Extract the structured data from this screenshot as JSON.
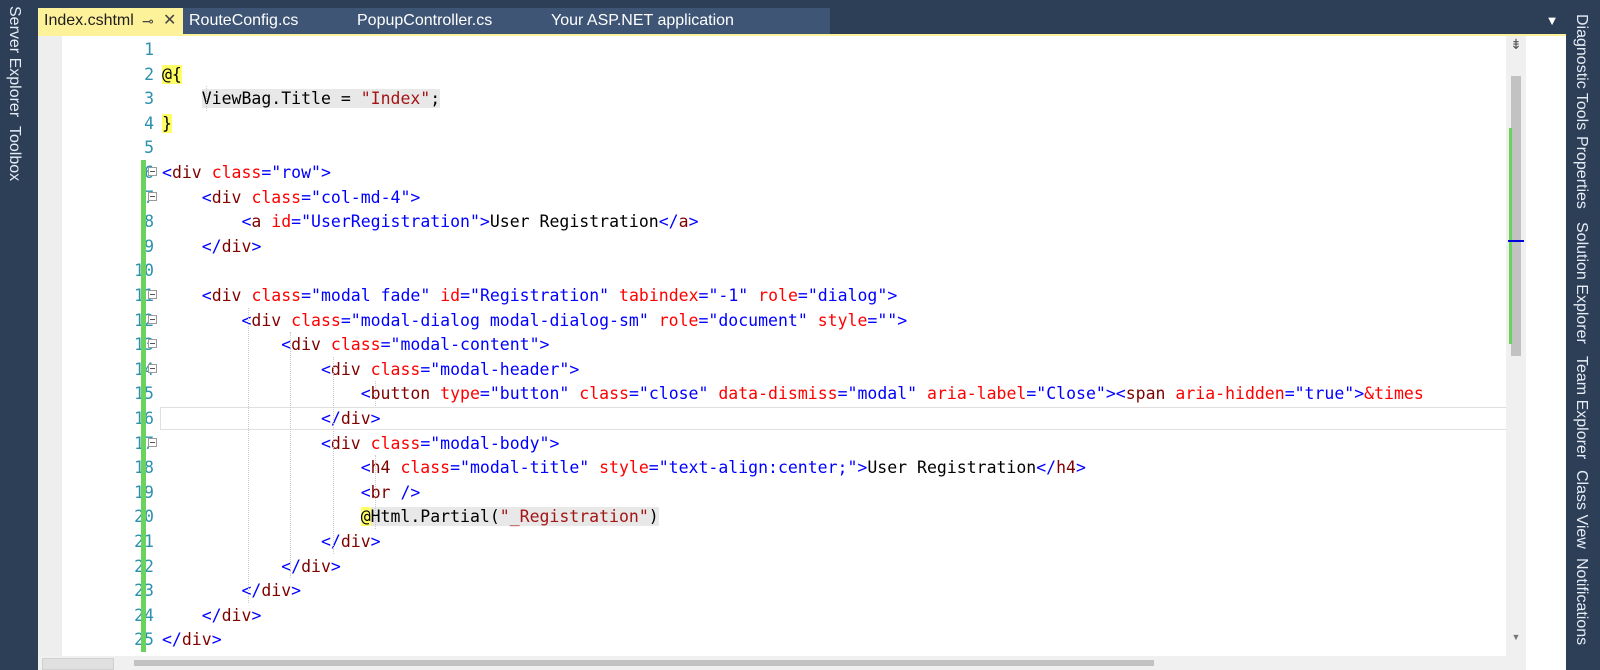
{
  "tabs": [
    {
      "label": "Index.cshtml",
      "active": true
    },
    {
      "label": "RouteConfig.cs",
      "active": false
    },
    {
      "label": "PopupController.cs",
      "active": false
    },
    {
      "label": "Your ASP.NET application",
      "active": false
    }
  ],
  "tab_icons": {
    "pin": "pin-icon",
    "close": "close-icon",
    "overflow": "dropdown-arrow-icon"
  },
  "tab_glyphs": {
    "pin": "⊸",
    "close": "✕",
    "overflow": "▼"
  },
  "left_panels": [
    "Server Explorer",
    "Toolbox"
  ],
  "right_panels": [
    "Diagnostic Tools",
    "Properties",
    "Solution Explorer",
    "Team Explorer",
    "Class View",
    "Notifications"
  ],
  "editor": {
    "lines": [
      {
        "number": "1",
        "text": ""
      },
      {
        "number": "2",
        "text": "@{"
      },
      {
        "number": "3",
        "text": "    ViewBag.Title = \"Index\";"
      },
      {
        "number": "4",
        "text": "}"
      },
      {
        "number": "5",
        "text": ""
      },
      {
        "number": "6",
        "text": "<div class=\"row\">"
      },
      {
        "number": "7",
        "text": "    <div class=\"col-md-4\">"
      },
      {
        "number": "8",
        "text": "        <a id=\"UserRegistration\">User Registration</a>"
      },
      {
        "number": "9",
        "text": "    </div>"
      },
      {
        "number": "10",
        "text": ""
      },
      {
        "number": "11",
        "text": "    <div class=\"modal fade\" id=\"Registration\" tabindex=\"-1\" role=\"dialog\">"
      },
      {
        "number": "12",
        "text": "        <div class=\"modal-dialog modal-dialog-sm\" role=\"document\" style=\"\">"
      },
      {
        "number": "13",
        "text": "            <div class=\"modal-content\">"
      },
      {
        "number": "14",
        "text": "                <div class=\"modal-header\">"
      },
      {
        "number": "15",
        "text": "                    <button type=\"button\" class=\"close\" data-dismiss=\"modal\" aria-label=\"Close\"><span aria-hidden=\"true\">&times"
      },
      {
        "number": "16",
        "text": "                </div>"
      },
      {
        "number": "17",
        "text": "                <div class=\"modal-body\">"
      },
      {
        "number": "18",
        "text": "                    <h4 class=\"modal-title\" style=\"text-align:center;\">User Registration</h4>"
      },
      {
        "number": "19",
        "text": "                    <br />"
      },
      {
        "number": "20",
        "text": "                    @Html.Partial(\"_Registration\")"
      },
      {
        "number": "21",
        "text": "                </div>"
      },
      {
        "number": "22",
        "text": "            </div>"
      },
      {
        "number": "23",
        "text": "        </div>"
      },
      {
        "number": "24",
        "text": "    </div>"
      },
      {
        "number": "25",
        "text": "</div>"
      }
    ],
    "foldable_lines": [
      6,
      7,
      11,
      12,
      13,
      14,
      17
    ],
    "changed_lines": [
      6,
      7,
      8,
      9,
      10,
      11,
      12,
      13,
      14,
      15,
      16,
      17,
      18,
      19,
      20,
      21,
      22,
      23,
      24,
      25
    ],
    "current_line": 16
  },
  "scrollbar": {
    "split_icon": "split-window-icon",
    "split_glyph": "⇟",
    "down_icon": "scroll-down-arrow-icon",
    "down_glyph": "▼"
  },
  "colors": {
    "chrome": "#2d3e57",
    "active_tab": "#fdf199",
    "line_number": "#2b91af",
    "tag": "#800000",
    "attribute": "#ff0000",
    "attribute_value": "#0000ff",
    "string": "#a31515",
    "change_marker": "#6ad35e"
  }
}
